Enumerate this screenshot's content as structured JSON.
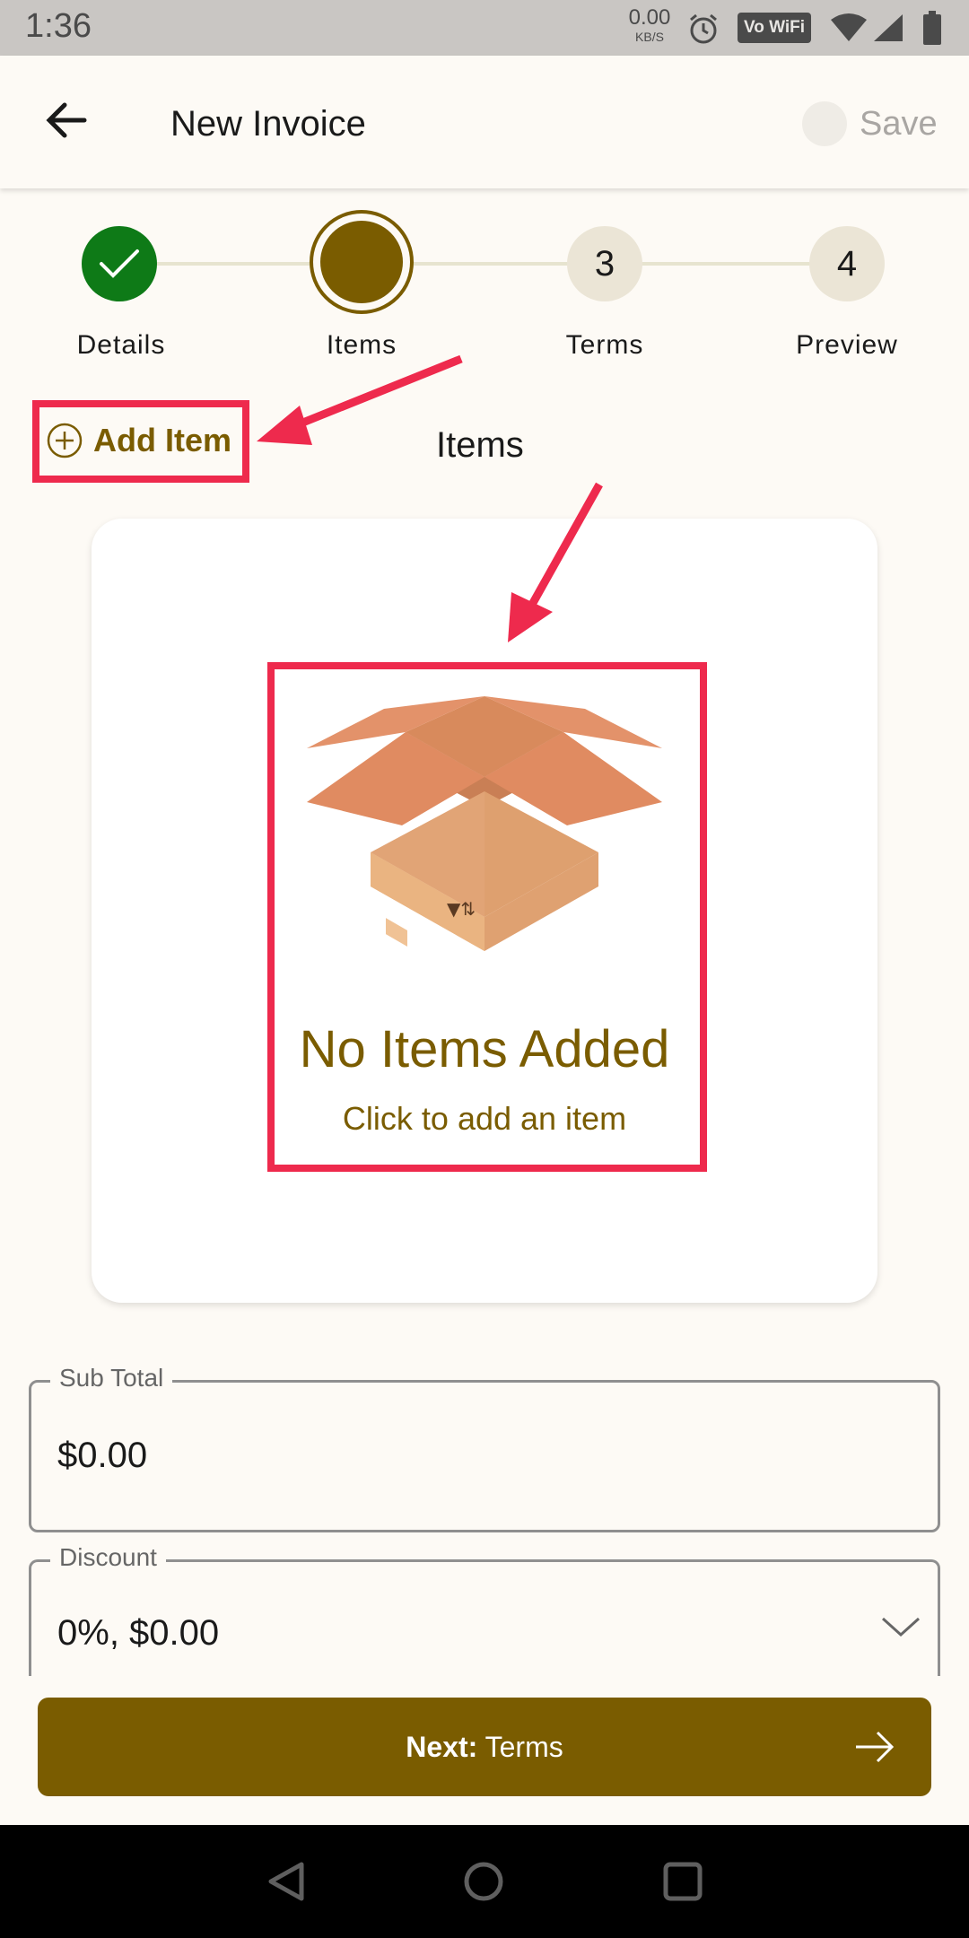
{
  "status_bar": {
    "time": "1:36",
    "speed_value": "0.00",
    "speed_unit": "KB/S",
    "vowifi": "Vo WiFi"
  },
  "app_bar": {
    "title": "New Invoice",
    "save_label": "Save"
  },
  "stepper": {
    "steps": [
      {
        "number": "",
        "label": "Details",
        "state": "done"
      },
      {
        "number": "",
        "label": "Items",
        "state": "current"
      },
      {
        "number": "3",
        "label": "Terms",
        "state": "pending"
      },
      {
        "number": "4",
        "label": "Preview",
        "state": "pending"
      }
    ]
  },
  "items_section": {
    "add_item_label": "Add Item",
    "title": "Items",
    "empty_title": "No Items Added",
    "empty_subtitle": "Click to add an item"
  },
  "fields": {
    "subtotal": {
      "label": "Sub Total",
      "value": "$0.00"
    },
    "discount": {
      "label": "Discount",
      "value": "0%, $0.00"
    }
  },
  "next_button": {
    "prefix": "Next:",
    "label": "Terms"
  },
  "colors": {
    "accent": "#7a5c00",
    "done": "#0e7a17",
    "annotation": "#ee2a4d",
    "background": "#fdfaf5"
  }
}
